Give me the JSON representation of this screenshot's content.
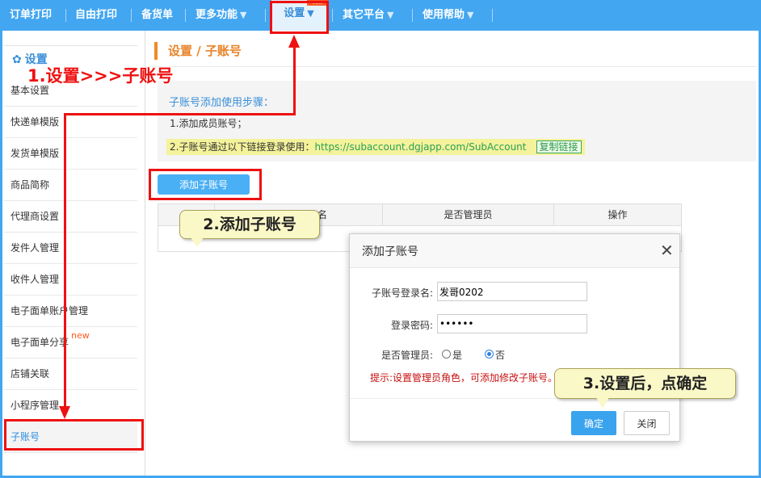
{
  "nav": {
    "items": [
      {
        "label": "订单打印"
      },
      {
        "label": "自由打印"
      },
      {
        "label": "备货单"
      },
      {
        "label": "更多功能",
        "arrow": "▼"
      },
      {
        "label": "设置",
        "arrow": "▼"
      },
      {
        "label": "其它平台",
        "arrow": "▼"
      },
      {
        "label": "使用帮助",
        "arrow": "▼"
      }
    ],
    "new_tag": "new"
  },
  "sidebar": {
    "header": "设置",
    "items": [
      {
        "label": "基本设置"
      },
      {
        "label": "快递单模版"
      },
      {
        "label": "发货单模版"
      },
      {
        "label": "商品简称"
      },
      {
        "label": "代理商设置"
      },
      {
        "label": "发件人管理"
      },
      {
        "label": "收件人管理"
      },
      {
        "label": "电子面单账户管理"
      },
      {
        "label": "电子面单分享"
      },
      {
        "label": "店铺关联"
      },
      {
        "label": "小程序管理"
      },
      {
        "label": "子账号"
      }
    ],
    "new_badge": "new"
  },
  "page": {
    "title": "设置 / 子账号"
  },
  "steps": {
    "title": "子账号添加使用步骤：",
    "step1": "1.添加成员账号；",
    "step2_prefix": "2.子账号通过以下链接登录使用：",
    "step2_link": "https://subaccount.dgjapp.com/SubAccount",
    "copy_label": "复制链接"
  },
  "add_button": "添加子账号",
  "table": {
    "headers": [
      "序",
      "名",
      "是否管理员",
      "操作"
    ]
  },
  "dialog": {
    "title": "添加子账号",
    "close_glyph": "✕",
    "login_label": "子账号登录名:",
    "login_value": "发哥0202",
    "password_label": "登录密码:",
    "password_value": "123456",
    "admin_label": "是否管理员:",
    "admin_yes": "是",
    "admin_no": "否",
    "admin_selected": "否",
    "hint": "提示:设置管理员角色，可添加修改子账号。",
    "ok_label": "确定",
    "close_label": "关闭"
  },
  "annotations": {
    "step1": "1.设置>>>子账号",
    "step2": "2.添加子账号",
    "step3": "3.设置后，点确定"
  },
  "colors": {
    "nav_bg": "#42a6f1",
    "accent_orange": "#e8842a",
    "annotation_red": "#ee1111",
    "primary_button": "#3aa3ee"
  }
}
